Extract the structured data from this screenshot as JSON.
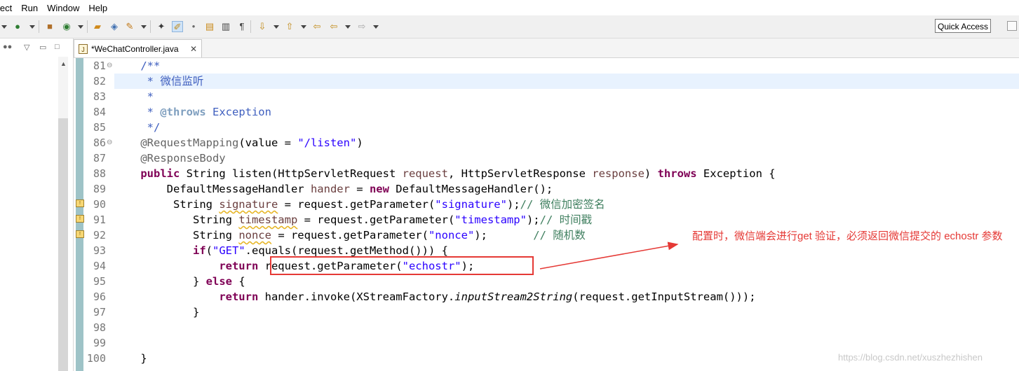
{
  "menu": [
    "ject",
    "Run",
    "Window",
    "Help"
  ],
  "toolbar": {
    "quick_access": "Quick Access"
  },
  "editor_tab": {
    "filename": "*WeChatController.java",
    "close": "✕"
  },
  "colors": {
    "keyword": "#7f0055",
    "string": "#2a00ff",
    "comment": "#3f7f5f",
    "javadoc": "#3f5fbf",
    "annotation_callout": "#e53935",
    "current_line": "#e8f2fe"
  },
  "line_numbers": [
    "81",
    "82",
    "83",
    "84",
    "85",
    "86",
    "87",
    "88",
    "89",
    "90",
    "91",
    "92",
    "93",
    "94",
    "95",
    "96",
    "97",
    "98",
    "99",
    "100"
  ],
  "code": {
    "l81": "/**",
    "l82": " * 微信监听",
    "l83": " *",
    "l84_star": " * ",
    "l84_tag": "@throws",
    "l84_rest": " Exception",
    "l85": " */",
    "l86_ann": "@RequestMapping",
    "l86_a": "(value = ",
    "l86_str": "\"/listen\"",
    "l86_b": ")",
    "l87": "@ResponseBody",
    "l88_kw": "public",
    "l88_a": " String listen(HttpServletRequest ",
    "l88_p1": "request",
    "l88_b": ", HttpServletResponse ",
    "l88_p2": "response",
    "l88_c": ") ",
    "l88_kw2": "throws",
    "l88_d": " Exception {",
    "l89_a": "    DefaultMessageHandler ",
    "l89_var": "hander",
    "l89_b": " = ",
    "l89_kw": "new",
    "l89_c": " DefaultMessageHandler();",
    "l90_a": "     String ",
    "l90_var": "signature",
    "l90_b": " = request.getParameter(",
    "l90_str": "\"signature\"",
    "l90_c": ");",
    "l90_cmt": "// 微信加密签名",
    "l91_a": "        String ",
    "l91_var": "timestamp",
    "l91_b": " = request.getParameter(",
    "l91_str": "\"timestamp\"",
    "l91_c": ");",
    "l91_cmt": "// 时间戳",
    "l92_a": "        String ",
    "l92_var": "nonce",
    "l92_b": " = request.getParameter(",
    "l92_str": "\"nonce\"",
    "l92_c": ");       ",
    "l92_cmt": "// 随机数",
    "l93_a": "        ",
    "l93_kw": "if",
    "l93_b": "(",
    "l93_str": "\"GET\"",
    "l93_c": ".equals(request.getMethod())) {",
    "l94_a": "            ",
    "l94_kw": "return",
    "l94_b": " request.getParameter(",
    "l94_str": "\"echostr\"",
    "l94_c": ");",
    "l95_a": "        } ",
    "l95_kw": "else",
    "l95_b": " {",
    "l96_a": "            ",
    "l96_kw": "return",
    "l96_b": " hander.invoke(XStreamFactory.",
    "l96_it": "inputStream2String",
    "l96_c": "(request.getInputStream()));",
    "l97": "        }",
    "l100": "}"
  },
  "callout": "配置时，微信端会进行get 验证，必须返回微信提交的 echostr 参数",
  "watermark": "https://blog.csdn.net/xuszhezhishen"
}
